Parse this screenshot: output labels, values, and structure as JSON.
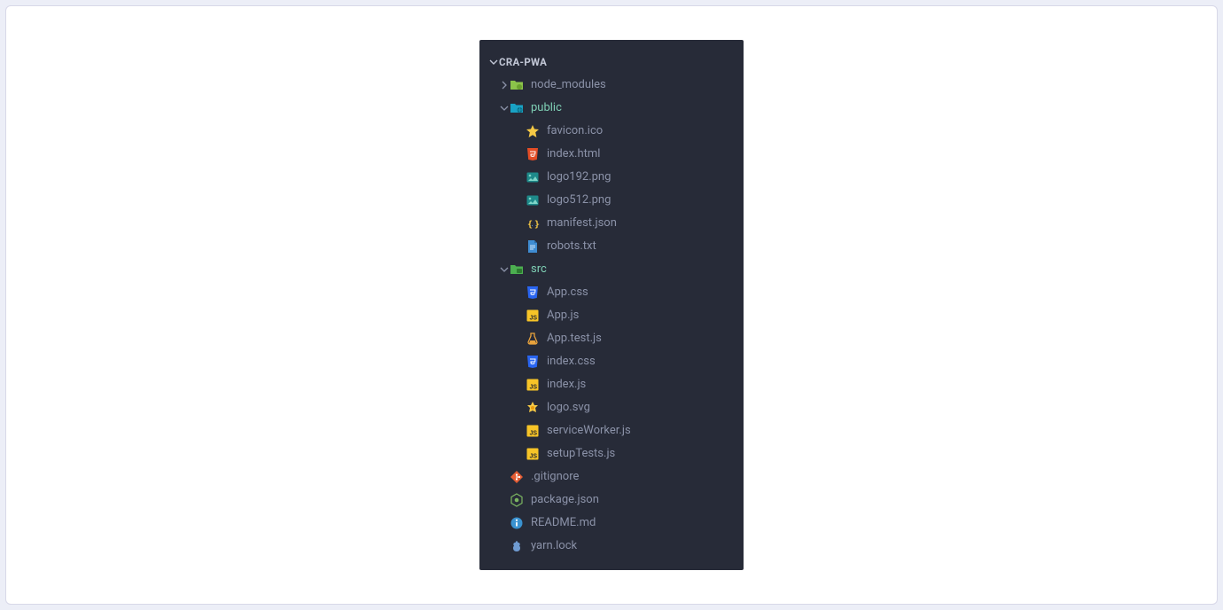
{
  "root": {
    "name": "CRA-PWA",
    "expanded": true
  },
  "tree": [
    {
      "type": "folder",
      "name": "node_modules",
      "expanded": false,
      "depth": 0,
      "icon": "folder-node",
      "open": false
    },
    {
      "type": "folder",
      "name": "public",
      "expanded": true,
      "depth": 0,
      "icon": "folder-public",
      "open": true
    },
    {
      "type": "file",
      "name": "favicon.ico",
      "depth": 1,
      "icon": "favicon"
    },
    {
      "type": "file",
      "name": "index.html",
      "depth": 1,
      "icon": "html"
    },
    {
      "type": "file",
      "name": "logo192.png",
      "depth": 1,
      "icon": "image"
    },
    {
      "type": "file",
      "name": "logo512.png",
      "depth": 1,
      "icon": "image"
    },
    {
      "type": "file",
      "name": "manifest.json",
      "depth": 1,
      "icon": "manifest"
    },
    {
      "type": "file",
      "name": "robots.txt",
      "depth": 1,
      "icon": "txt"
    },
    {
      "type": "folder",
      "name": "src",
      "expanded": true,
      "depth": 0,
      "icon": "folder-src",
      "open": true
    },
    {
      "type": "file",
      "name": "App.css",
      "depth": 1,
      "icon": "css"
    },
    {
      "type": "file",
      "name": "App.js",
      "depth": 1,
      "icon": "js"
    },
    {
      "type": "file",
      "name": "App.test.js",
      "depth": 1,
      "icon": "test"
    },
    {
      "type": "file",
      "name": "index.css",
      "depth": 1,
      "icon": "css"
    },
    {
      "type": "file",
      "name": "index.js",
      "depth": 1,
      "icon": "js"
    },
    {
      "type": "file",
      "name": "logo.svg",
      "depth": 1,
      "icon": "svg"
    },
    {
      "type": "file",
      "name": "serviceWorker.js",
      "depth": 1,
      "icon": "js"
    },
    {
      "type": "file",
      "name": "setupTests.js",
      "depth": 1,
      "icon": "js"
    },
    {
      "type": "file",
      "name": ".gitignore",
      "depth": 0,
      "icon": "git"
    },
    {
      "type": "file",
      "name": "package.json",
      "depth": 0,
      "icon": "npm"
    },
    {
      "type": "file",
      "name": "README.md",
      "depth": 0,
      "icon": "readme"
    },
    {
      "type": "file",
      "name": "yarn.lock",
      "depth": 0,
      "icon": "yarn"
    }
  ]
}
